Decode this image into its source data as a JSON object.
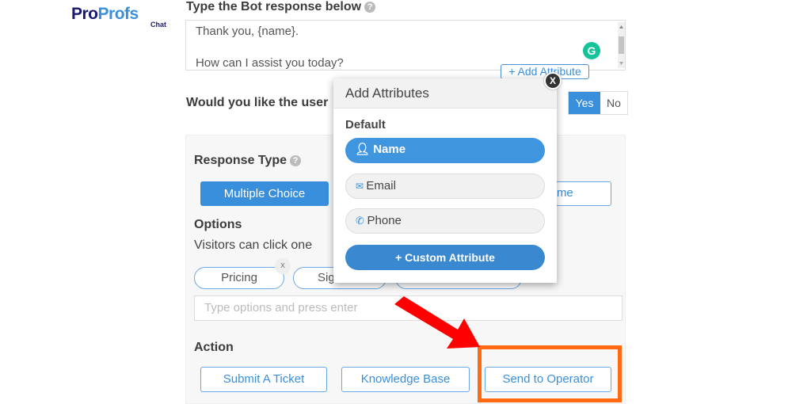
{
  "logo": {
    "brand_a": "Pro",
    "brand_b": "Profs",
    "sub": "Chat"
  },
  "bot_response": {
    "title": "Type the Bot response below",
    "line1": "Thank you,  {name}.",
    "line2": "How can I assist you today?",
    "add_attribute": "+ Add Attribute",
    "help": "?"
  },
  "question": {
    "label": "Would you like the user",
    "yes": "Yes",
    "no": "No"
  },
  "response_type": {
    "title": "Response Type",
    "help": "?",
    "multiple_choice": "Multiple Choice",
    "time_partial": "Time"
  },
  "options": {
    "title": "Options",
    "hint": "Visitors can click one",
    "chips": [
      "Pricing",
      "Sig"
    ],
    "remove": "x",
    "input_placeholder": "Type options and press enter"
  },
  "action": {
    "title": "Action",
    "buttons": [
      "Submit A Ticket",
      "Knowledge Base",
      "Send to Operator"
    ]
  },
  "popup": {
    "title": "Add Attributes",
    "close": "X",
    "section": "Default",
    "items": [
      {
        "label": "Name",
        "icon": "user-icon"
      },
      {
        "label": "Email",
        "icon": "envelope-icon"
      },
      {
        "label": "Phone",
        "icon": "phone-icon"
      }
    ],
    "custom": "+ Custom Attribute"
  },
  "colors": {
    "accent": "#3a8fdc",
    "highlight": "#ff6a13",
    "arrow": "#ff0000"
  }
}
